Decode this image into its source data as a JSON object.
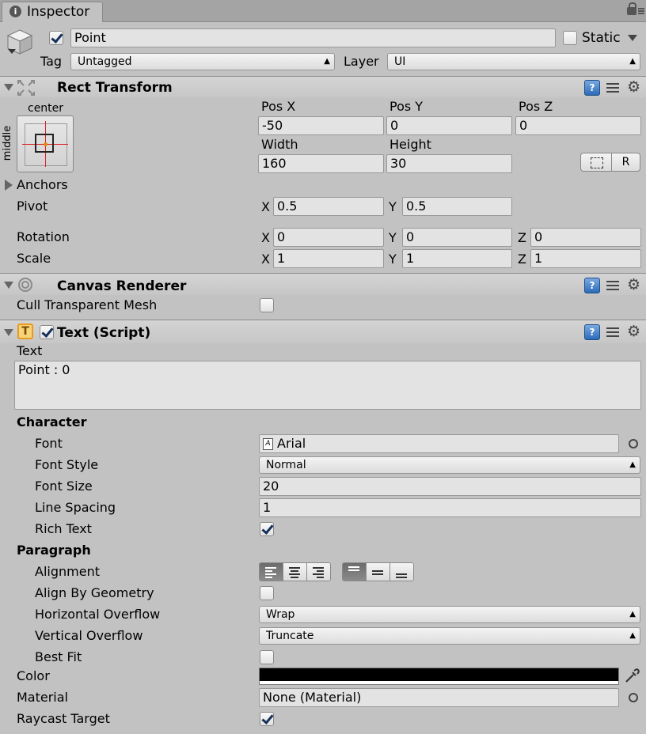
{
  "tab": {
    "title": "Inspector"
  },
  "object": {
    "name": "Point",
    "active": true,
    "static_label": "Static",
    "static": false,
    "tag_label": "Tag",
    "tag_value": "Untagged",
    "layer_label": "Layer",
    "layer_value": "UI"
  },
  "rect_transform": {
    "title": "Rect Transform",
    "anchor_h": "center",
    "anchor_v": "middle",
    "pos_x_label": "Pos X",
    "pos_y_label": "Pos Y",
    "pos_z_label": "Pos Z",
    "pos_x": "-50",
    "pos_y": "0",
    "pos_z": "0",
    "width_label": "Width",
    "height_label": "Height",
    "width": "160",
    "height": "30",
    "raw_button": "R",
    "anchors_label": "Anchors",
    "pivot_label": "Pivot",
    "pivot_x": "0.5",
    "pivot_y": "0.5",
    "rotation_label": "Rotation",
    "rot_x": "0",
    "rot_y": "0",
    "rot_z": "0",
    "scale_label": "Scale",
    "scale_x": "1",
    "scale_y": "1",
    "scale_z": "1",
    "x": "X",
    "y": "Y",
    "z": "Z"
  },
  "canvas_renderer": {
    "title": "Canvas Renderer",
    "cull_label": "Cull Transparent Mesh",
    "cull": false
  },
  "text_script": {
    "title": "Text (Script)",
    "text_label": "Text",
    "text_value": "Point : 0",
    "character_label": "Character",
    "font_label": "Font",
    "font_value": "Arial",
    "font_style_label": "Font Style",
    "font_style_value": "Normal",
    "font_size_label": "Font Size",
    "font_size_value": "20",
    "line_spacing_label": "Line Spacing",
    "line_spacing_value": "1",
    "rich_text_label": "Rich Text",
    "rich_text": true,
    "paragraph_label": "Paragraph",
    "alignment_label": "Alignment",
    "align_geometry_label": "Align By Geometry",
    "align_geometry": false,
    "h_overflow_label": "Horizontal Overflow",
    "h_overflow_value": "Wrap",
    "v_overflow_label": "Vertical Overflow",
    "v_overflow_value": "Truncate",
    "best_fit_label": "Best Fit",
    "best_fit": false,
    "color_label": "Color",
    "color_value": "#000000",
    "material_label": "Material",
    "material_value": "None (Material)",
    "raycast_label": "Raycast Target",
    "raycast": true
  }
}
